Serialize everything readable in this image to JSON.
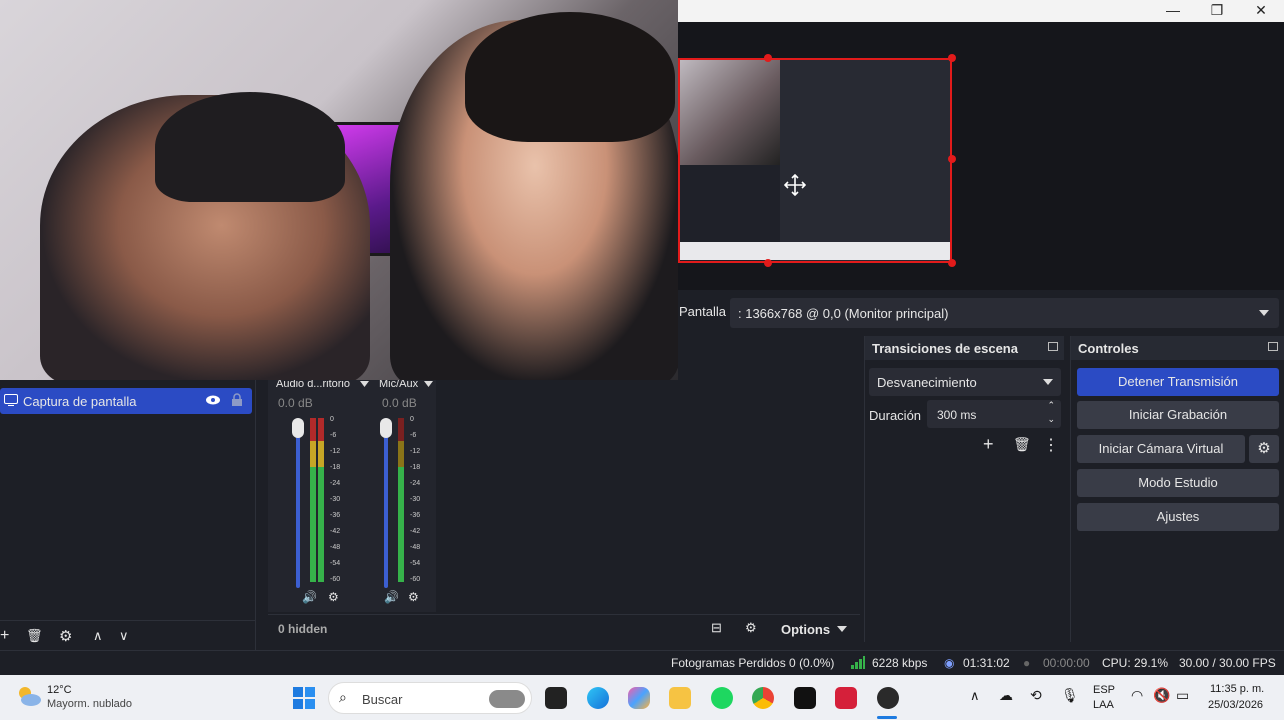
{
  "window": {
    "minimize": "—",
    "maximize": "❐",
    "close": "✕"
  },
  "source_bar": {
    "label": "Pantalla",
    "value": ": 1366x768 @ 0,0 (Monitor principal)"
  },
  "sources": {
    "item_label": "Captura de pantalla",
    "toolbar": [
      "+",
      "🗑",
      "⚙",
      "∧",
      "∨"
    ]
  },
  "mixer": {
    "channels": [
      {
        "name": "Audio d...ritorio",
        "db": "0.0 dB"
      },
      {
        "name": "Mic/Aux",
        "db": "0.0 dB"
      }
    ],
    "ticks": [
      "0",
      "-6",
      "-12",
      "-18",
      "-24",
      "-30",
      "-36",
      "-42",
      "-48",
      "-54",
      "-60"
    ],
    "hidden_label": "0 hidden",
    "options_label": "Options"
  },
  "transitions": {
    "title": "Transiciones de escena",
    "selected": "Desvanecimiento",
    "duration_label": "Duración",
    "duration_value": "300 ms"
  },
  "controls": {
    "title": "Controles",
    "stop_stream": "Detener Transmisión",
    "start_recording": "Iniciar Grabación",
    "virtual_camera": "Iniciar Cámara Virtual",
    "studio_mode": "Modo Estudio",
    "settings": "Ajustes"
  },
  "status": {
    "dropped_frames": "Fotogramas Perdidos 0 (0.0%)",
    "bitrate": "6228 kbps",
    "stream_time": "01:31:02",
    "rec_time": "00:00:00",
    "cpu": "CPU: 29.1%",
    "fps": "30.00 / 30.00 FPS"
  },
  "taskbar": {
    "weather_temp": "12°C",
    "weather_desc": "Mayorm. nublado",
    "search_placeholder": "Buscar",
    "lang_top": "ESP",
    "lang_bottom": "LAA",
    "time": "11:35 p. m.",
    "date": "25/03/2026"
  },
  "colors": {
    "accent": "#2b4bc4",
    "selection_border": "#e21b1b",
    "meter_green": "#36b24a",
    "meter_yellow": "#c6a626",
    "meter_red": "#b22a2a"
  }
}
